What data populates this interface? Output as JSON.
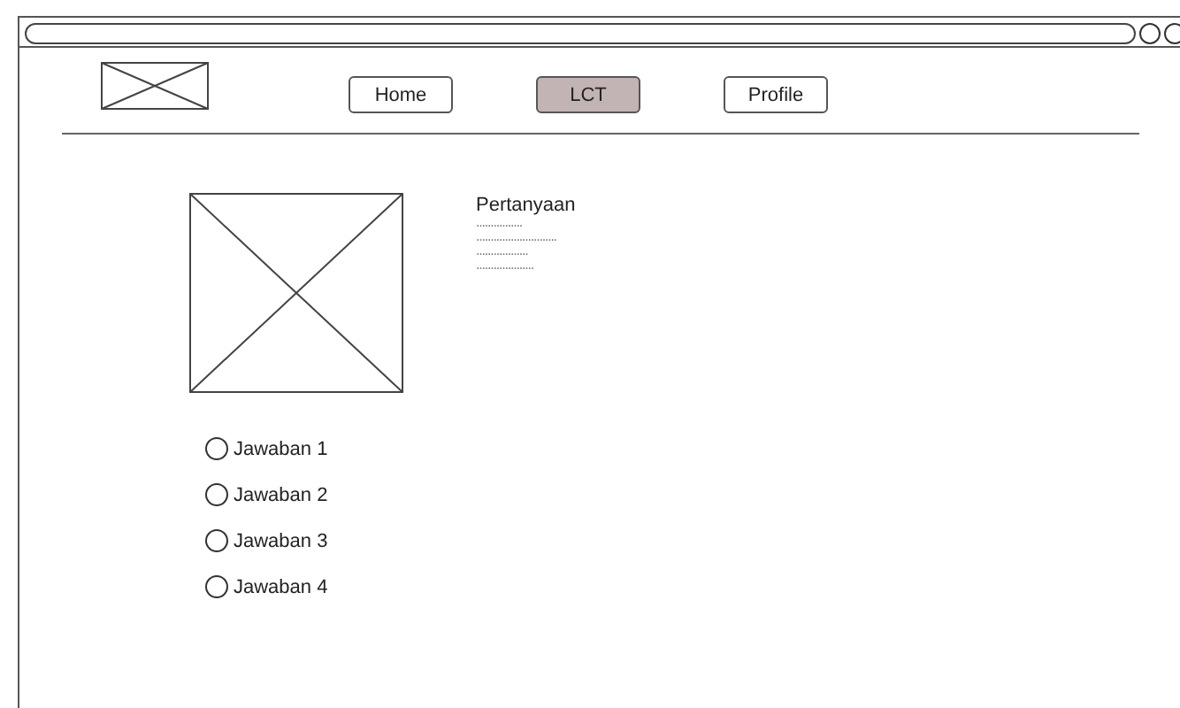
{
  "nav": [
    {
      "label": "Home",
      "selected": false
    },
    {
      "label": "LCT",
      "selected": true
    },
    {
      "label": "Profile",
      "selected": false
    }
  ],
  "question": {
    "title": "Pertanyaan",
    "lines": [
      "................",
      "............................",
      "..................",
      "...................."
    ]
  },
  "answers": [
    {
      "label": "Jawaban 1",
      "selected": false
    },
    {
      "label": "Jawaban 2",
      "selected": false
    },
    {
      "label": "Jawaban 3",
      "selected": false
    },
    {
      "label": "Jawaban 4",
      "selected": false
    }
  ]
}
